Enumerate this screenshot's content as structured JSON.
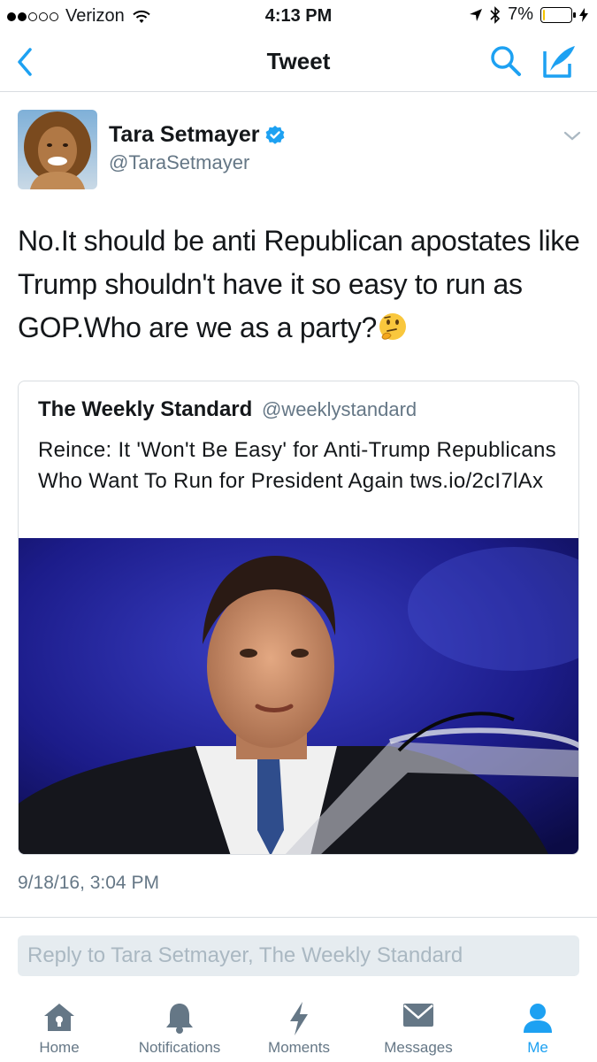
{
  "status_bar": {
    "carrier": "Verizon",
    "time": "4:13 PM",
    "battery_percent": "7%",
    "battery_level": 0.07,
    "signal_bars_filled": 2,
    "signal_bars_total": 5
  },
  "nav": {
    "title": "Tweet",
    "icons": [
      "back-chevron-icon",
      "search-icon",
      "compose-icon"
    ]
  },
  "tweet": {
    "author_name": "Tara Setmayer",
    "author_handle": "@TaraSetmayer",
    "verified": true,
    "text": "No.It should be anti Republican apostates like Trump shouldn't have it so easy to run as GOP.Who are we as a party?",
    "emoji": "thinking-face",
    "timestamp": "9/18/16, 3:04 PM"
  },
  "quoted_tweet": {
    "author_name": "The Weekly Standard",
    "author_handle": "@weeklystandard",
    "text": "Reince: It 'Won't Be Easy' for Anti-Trump Republicans Who Want To Run for President Again tws.io/2cI7lAx"
  },
  "reply": {
    "placeholder": "Reply to Tara Setmayer, The Weekly Standard",
    "value": ""
  },
  "tab_bar": {
    "tabs": [
      {
        "label": "Home",
        "icon": "home-icon",
        "active": false
      },
      {
        "label": "Notifications",
        "icon": "bell-icon",
        "active": false
      },
      {
        "label": "Moments",
        "icon": "lightning-icon",
        "active": false
      },
      {
        "label": "Messages",
        "icon": "envelope-icon",
        "active": false
      },
      {
        "label": "Me",
        "icon": "person-icon",
        "active": true
      }
    ]
  },
  "colors": {
    "accent": "#1da1f2",
    "secondary_text": "#657786",
    "battery_low": "#f5c400"
  }
}
